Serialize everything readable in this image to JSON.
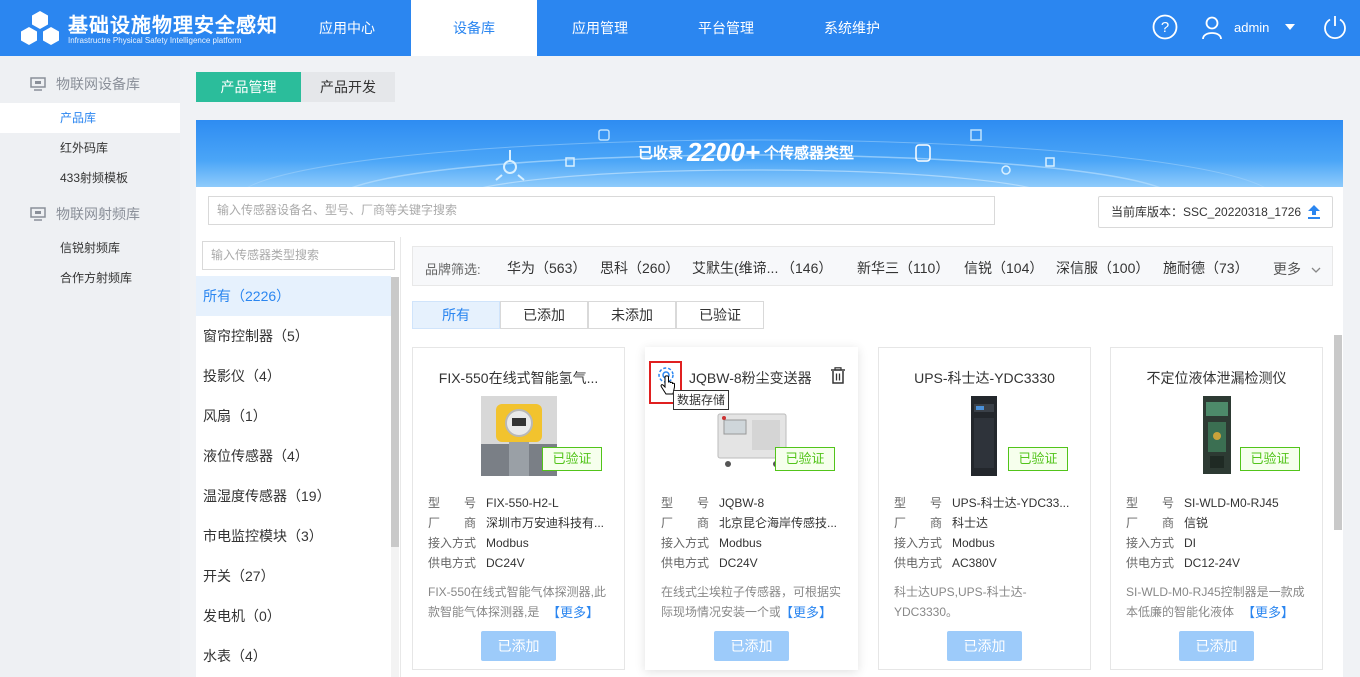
{
  "header": {
    "title": "基础设施物理安全感知",
    "subtitle": "Infrastructre Physical Safety Intelligence platform",
    "nav": [
      "应用中心",
      "设备库",
      "应用管理",
      "平台管理",
      "系统维护"
    ],
    "active_nav": "设备库",
    "user": "admin",
    "brand_color": "#2b86f0"
  },
  "sidebar": {
    "groups": [
      {
        "label": "物联网设备库",
        "items": [
          "产品库",
          "红外码库",
          "433射频模板"
        ]
      },
      {
        "label": "物联网射频库",
        "items": [
          "信锐射频库",
          "合作方射频库"
        ]
      }
    ],
    "active_item": "产品库"
  },
  "top_tabs": [
    "产品管理",
    "产品开发"
  ],
  "banner": {
    "prefix": "已收录",
    "number": "2200+",
    "suffix": "个传感器类型"
  },
  "search": {
    "placeholder": "输入传感器设备名、型号、厂商等关键字搜索"
  },
  "version": {
    "text": "当前库版本：SSC_20220318_1726"
  },
  "categories": {
    "search_placeholder": "输入传感器类型搜索",
    "items": [
      "所有（2226）",
      "窗帘控制器（5）",
      "投影仪（4）",
      "风扇（1）",
      "液位传感器（4）",
      "温湿度传感器（19）",
      "市电监控模块（3）",
      "开关（27）",
      "发电机（0）",
      "水表（4）"
    ]
  },
  "brand_filter": {
    "label": "品牌筛选:",
    "brands": [
      "华为（563）",
      "思科（260）",
      "艾默生(维谛...",
      "（146）",
      "新华三（110）",
      "信锐（104）",
      "深信服（100）",
      "施耐德（73）"
    ],
    "more": "更多"
  },
  "filter_tabs": [
    "所有",
    "已添加",
    "未添加",
    "已验证"
  ],
  "field_labels": {
    "model": "型　　号",
    "vendor": "厂　　商",
    "access": "接入方式",
    "power": "供电方式"
  },
  "cards": [
    {
      "title": "FIX-550在线式智能氢气...",
      "badge": "已验证",
      "model": "FIX-550-H2-L",
      "vendor": "深圳市万安迪科技有...",
      "access": "Modbus",
      "power": "DC24V",
      "desc": "FIX-550在线式智能气体探测器,此款智能气体探测器,是",
      "more": "【更多】",
      "button": "已添加"
    },
    {
      "title": "JQBW-8粉尘变送器",
      "badge": "已验证",
      "model": "JQBW-8",
      "vendor": "北京昆仑海岸传感技...",
      "access": "Modbus",
      "power": "DC24V",
      "desc": "在线式尘埃粒子传感器，可根据实际现场情况安装一个或",
      "more": "【更多】",
      "button": "已添加",
      "tooltip": "数据存储"
    },
    {
      "title": "UPS-科士达-YDC3330",
      "badge": "已验证",
      "model": "UPS-科士达-YDC33...",
      "vendor": "科士达",
      "access": "Modbus",
      "power": "AC380V",
      "desc": "科士达UPS,UPS-科士达-YDC3330。",
      "more": "",
      "button": "已添加"
    },
    {
      "title": "不定位液体泄漏检测仪",
      "badge": "已验证",
      "model": "SI-WLD-M0-RJ45",
      "vendor": "信锐",
      "access": "DI",
      "power": "DC12-24V",
      "desc": "SI-WLD-M0-RJ45控制器是一款成本低廉的智能化液体",
      "more": "【更多】",
      "button": "已添加"
    }
  ]
}
